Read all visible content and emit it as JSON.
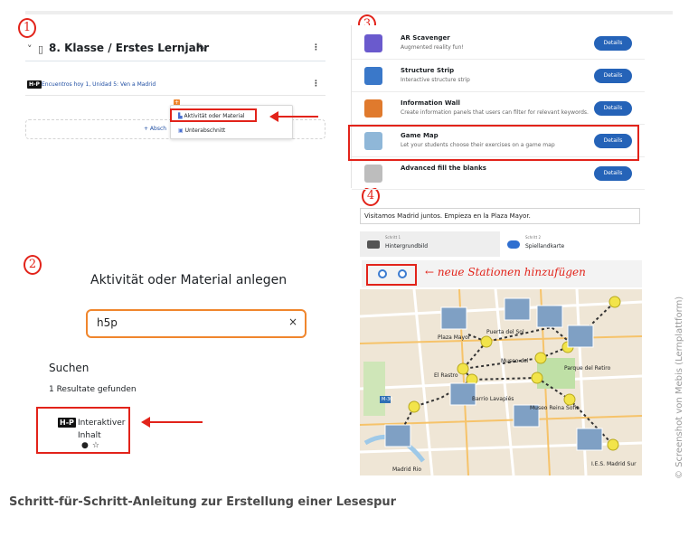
{
  "steps": [
    "1",
    "2",
    "3",
    "4"
  ],
  "panel1": {
    "section_title": "8. Klasse / Erstes Lernjahr",
    "activity": "Encuentros hoy 1, Unidad 5: Ven a Madrid",
    "menu_items": [
      "Aktivität oder Material",
      "Unterabschnitt"
    ],
    "add_partial": "+ Absch"
  },
  "panel2": {
    "title": "Aktivität oder Material anlegen",
    "search_value": "h5p",
    "clear_icon": "×",
    "search_heading": "Suchen",
    "result_count": "1 Resultate gefunden",
    "result_badge": "H-P",
    "result_name_line1": "Interaktiver",
    "result_name_line2": "Inhalt",
    "result_icons": "●☆"
  },
  "panel3": {
    "items": [
      {
        "name": "AR Scavenger",
        "desc": "Augmented reality fun!",
        "button": "Details",
        "icon_color": "#6a5acd"
      },
      {
        "name": "Structure Strip",
        "desc": "Interactive structure strip",
        "button": "Details",
        "icon_color": "#3a78c9"
      },
      {
        "name": "Information Wall",
        "desc": "Create information panels that users can filter for relevant keywords.",
        "button": "Details",
        "icon_color": "#e07a2d"
      },
      {
        "name": "Game Map",
        "desc": "Let your students choose their exercises on a game map",
        "button": "Details",
        "icon_color": "#8fb7d8"
      },
      {
        "name": "Advanced fill the blanks",
        "desc": "",
        "button": "Details",
        "icon_color": "#bdbdbd"
      }
    ]
  },
  "panel4": {
    "text_field": "Visitamos Madrid juntos. Empieza en la Plaza Mayor.",
    "tab1_step": "Schritt 1",
    "tab1_label": "Hintergrundbild",
    "tab2_step": "Schritt 2",
    "tab2_label": "Spiellandkarte",
    "note": "← neue Stationen hinzufügen",
    "map_labels": [
      "Plaza Mayor",
      "Puerta del Sol",
      "Museo del",
      "El Rastro",
      "Barrio Lavapiés",
      "Parque del Retiro",
      "Museo Reina Sofia",
      "Madrid Rio",
      "I.E.S. Madrid Sur",
      "M-30"
    ]
  },
  "caption": "Schritt-für-Schritt-Anleitung zur Erstellung einer Lesespur",
  "credit": "© Screenshot von Mebis (Lernplattform)",
  "colors": {
    "accent_red": "#e2231a",
    "button_blue": "#2563b8",
    "orange": "#f0862d"
  }
}
